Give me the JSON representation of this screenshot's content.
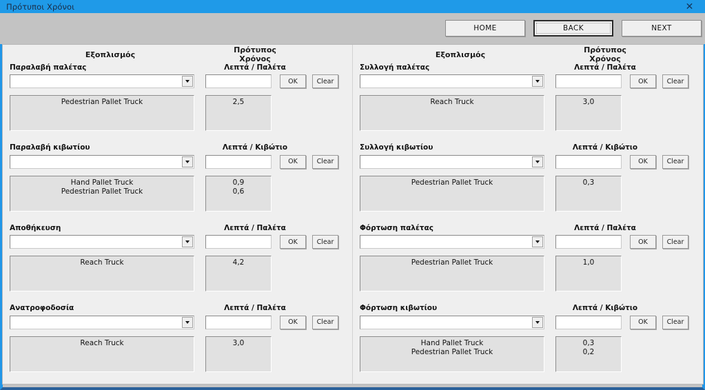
{
  "window": {
    "title": "Πρότυποι Χρόνοι",
    "close_icon": "close-icon",
    "close_glyph": "✕",
    "accent_color": "#1f9ae8",
    "panel_color": "#efefef",
    "toolbar_color": "#c3c3c3"
  },
  "toolbar": {
    "home_label": "HOME",
    "back_label": "BACK",
    "next_label": "NEXT"
  },
  "columns": [
    {
      "head_equipment": "Εξοπλισμός",
      "head_time": "Πρότυπος Χρόνος",
      "groups": [
        {
          "title": "Παραλαβή παλέτας",
          "unit": "Λεπτά / Παλέτα",
          "combo_value": "",
          "input_value": "",
          "ok_label": "OK",
          "clear_label": "Clear",
          "results": [
            "Pedestrian Pallet Truck"
          ],
          "values": [
            "2,5"
          ]
        },
        {
          "title": "Παραλαβή κιβωτίου",
          "unit": "Λεπτά / Κιβώτιο",
          "combo_value": "",
          "input_value": "",
          "ok_label": "OK",
          "clear_label": "Clear",
          "results": [
            "Hand Pallet Truck",
            "Pedestrian Pallet Truck"
          ],
          "values": [
            "0,9",
            "0,6"
          ]
        },
        {
          "title": "Αποθήκευση",
          "unit": "Λεπτά / Παλέτα",
          "combo_value": "",
          "input_value": "",
          "ok_label": "OK",
          "clear_label": "Clear",
          "results": [
            "Reach Truck"
          ],
          "values": [
            "4,2"
          ]
        },
        {
          "title": "Ανατροφοδοσία",
          "unit": "Λεπτά / Παλέτα",
          "combo_value": "",
          "input_value": "",
          "ok_label": "OK",
          "clear_label": "Clear",
          "results": [
            "Reach Truck"
          ],
          "values": [
            "3,0"
          ]
        }
      ]
    },
    {
      "head_equipment": "Εξοπλισμός",
      "head_time": "Πρότυπος Χρόνος",
      "groups": [
        {
          "title": "Συλλογή παλέτας",
          "unit": "Λεπτά / Παλέτα",
          "combo_value": "",
          "input_value": "",
          "ok_label": "OK",
          "clear_label": "Clear",
          "results": [
            "Reach Truck"
          ],
          "values": [
            "3,0"
          ]
        },
        {
          "title": "Συλλογή κιβωτίου",
          "unit": "Λεπτά / Κιβώτιο",
          "combo_value": "",
          "input_value": "",
          "ok_label": "OK",
          "clear_label": "Clear",
          "results": [
            "Pedestrian Pallet Truck"
          ],
          "values": [
            "0,3"
          ]
        },
        {
          "title": "Φόρτωση παλέτας",
          "unit": "Λεπτά / Παλέτα",
          "combo_value": "",
          "input_value": "",
          "ok_label": "OK",
          "clear_label": "Clear",
          "results": [
            "Pedestrian Pallet Truck"
          ],
          "values": [
            "1,0"
          ]
        },
        {
          "title": "Φόρτωση κιβωτίου",
          "unit": "Λεπτά / Κιβώτιο",
          "combo_value": "",
          "input_value": "",
          "ok_label": "OK",
          "clear_label": "Clear",
          "results": [
            "Hand Pallet Truck",
            "Pedestrian Pallet Truck"
          ],
          "values": [
            "0,3",
            "0,2"
          ]
        }
      ]
    }
  ]
}
